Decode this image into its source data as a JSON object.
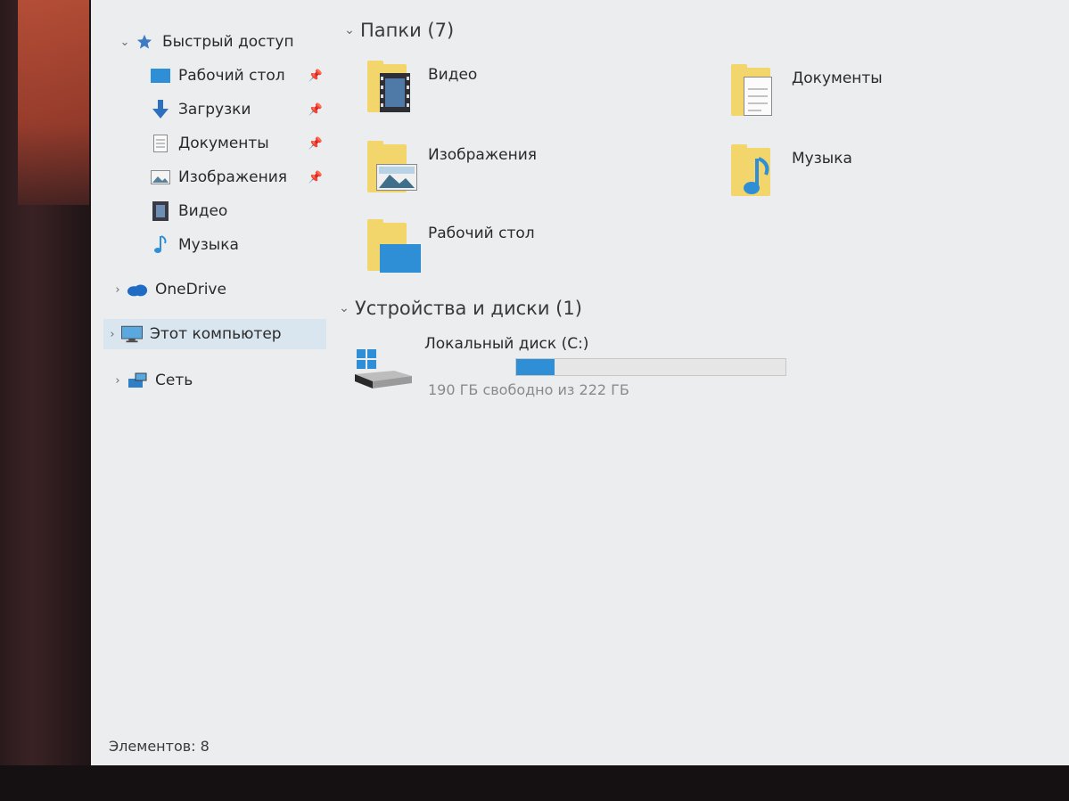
{
  "nav": {
    "quick_access": "Быстрый доступ",
    "quick_items": [
      {
        "label": "Рабочий стол",
        "pinned": true
      },
      {
        "label": "Загрузки",
        "pinned": true
      },
      {
        "label": "Документы",
        "pinned": true
      },
      {
        "label": "Изображения",
        "pinned": true
      },
      {
        "label": "Видео",
        "pinned": false
      },
      {
        "label": "Музыка",
        "pinned": false
      }
    ],
    "onedrive": "OneDrive",
    "this_pc": "Этот компьютер",
    "network": "Сеть"
  },
  "content": {
    "folders_header": "Папки (7)",
    "folders": [
      {
        "label": "Видео",
        "icon": "video-icon"
      },
      {
        "label": "Документы",
        "icon": "document-icon"
      },
      {
        "label": "Изображения",
        "icon": "image-icon"
      },
      {
        "label": "Музыка",
        "icon": "music-icon"
      },
      {
        "label": "Рабочий стол",
        "icon": "desktop-icon"
      }
    ],
    "devices_header": "Устройства и диски (1)",
    "drive": {
      "label": "Локальный диск (C:)",
      "free_text": "190 ГБ свободно из 222 ГБ",
      "used_fraction": 0.144
    }
  },
  "status": "Элементов: 8",
  "colors": {
    "accent": "#2e8fd6",
    "folder": "#f2d56b",
    "selected": "#d9e6ef"
  }
}
